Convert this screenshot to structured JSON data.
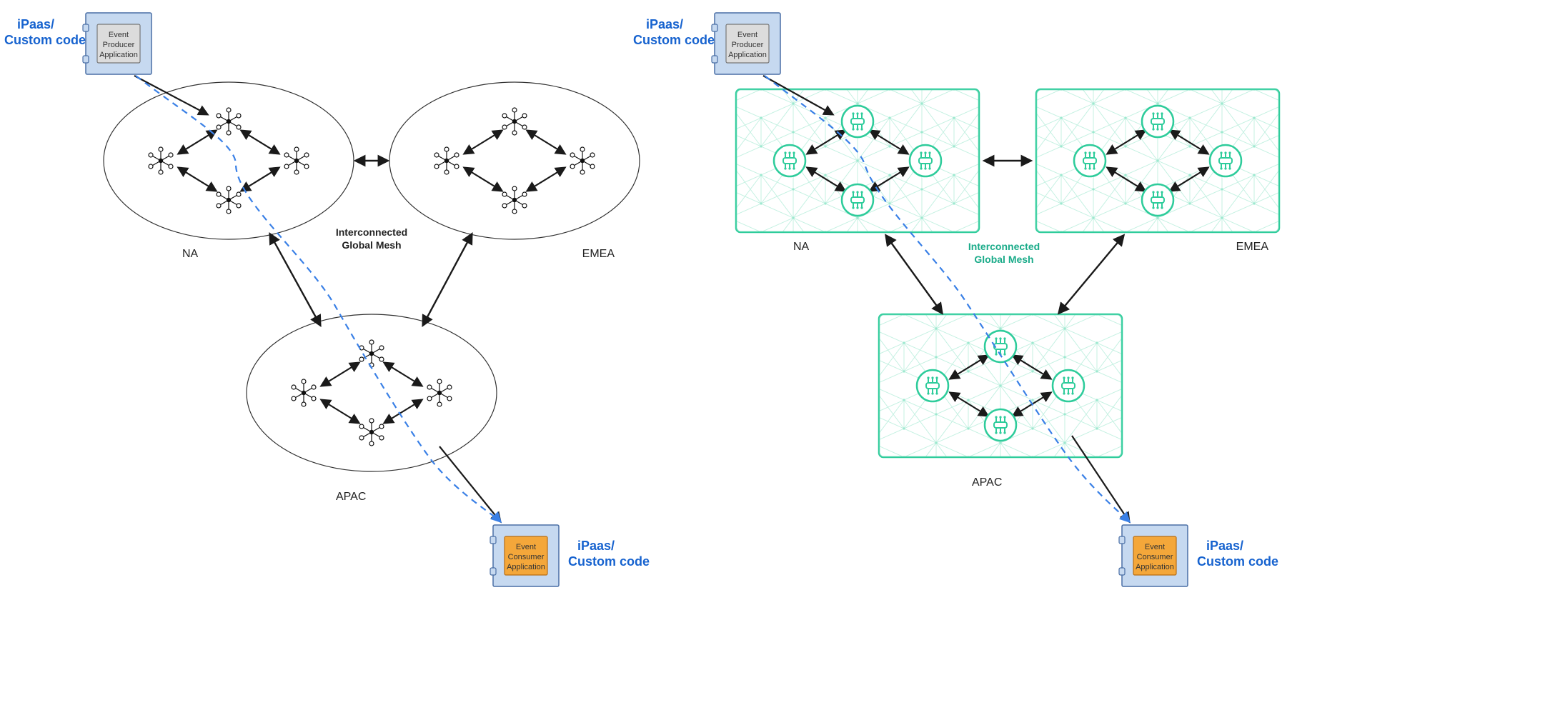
{
  "labels": {
    "ipaas_producer": "iPaas/",
    "ipaas_producer2": "Custom code",
    "ipaas_consumer": "iPaas/",
    "ipaas_consumer2": "Custom code",
    "event_producer_l1": "Event",
    "event_producer_l2": "Producer",
    "event_producer_l3": "Application",
    "event_consumer_l1": "Event",
    "event_consumer_l2": "Consumer",
    "event_consumer_l3": "Application",
    "na": "NA",
    "emea": "EMEA",
    "apac": "APAC",
    "mesh_l1": "Interconnected",
    "mesh_l2": "Global Mesh"
  },
  "colors": {
    "blueText": "#1763cf",
    "appBoxFill": "#c6d9f0",
    "appBoxStroke": "#4a6fa5",
    "innerGrayFill": "#dcdcdc",
    "innerGrayStroke": "#777",
    "orangeFill": "#f4a73a",
    "orangeStroke": "#b86d12",
    "green": "#2ecc9b",
    "greenDark": "#1aab89",
    "greenLight": "#e7faf3",
    "arrow": "#1a1a1a",
    "dashedBlue": "#3a80e6"
  }
}
